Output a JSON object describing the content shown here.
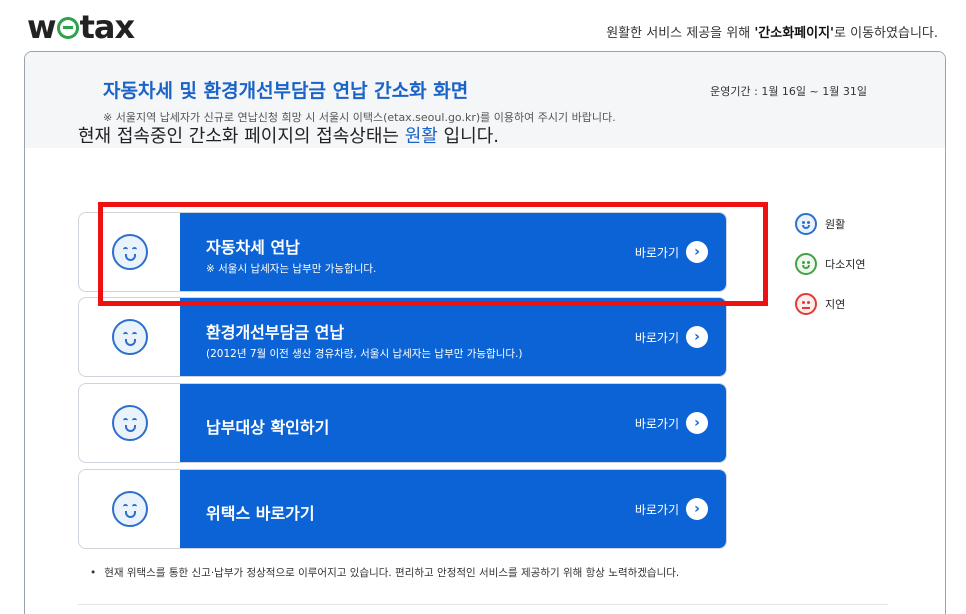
{
  "header": {
    "logo": "wetax",
    "notice_prefix": "원활한 서비스 제공을 위해 ",
    "notice_strong": "'간소화페이지'",
    "notice_suffix": "로 이동하였습니다."
  },
  "panel": {
    "title": "자동차세 및 환경개선부담금 연납 간소화 화면",
    "subtitle": "※ 서울지역 납세자가 신규로 연납신청 희망 시 서울시 이택스(etax.seoul.go.kr)를 이용하여 주시기 바랍니다.",
    "period": "운영기간 : 1월 16일 ~ 1월 31일"
  },
  "status": {
    "prefix": "현재 접속중인 간소화 페이지의 접속상태는 ",
    "value": "원활",
    "suffix": " 입니다."
  },
  "menu": [
    {
      "title": "자동차세 연납",
      "desc": "※ 서울시 납세자는 납부만 가능합니다.",
      "go_label": "바로가기"
    },
    {
      "title": "환경개선부담금 연납",
      "desc": "(2012년 7월 이전 생산 경유차량, 서울시 납세자는 납부만 가능합니다.)",
      "go_label": "바로가기"
    },
    {
      "title": "납부대상 확인하기",
      "desc": "",
      "go_label": "바로가기"
    },
    {
      "title": "위택스 바로가기",
      "desc": "",
      "go_label": "바로가기"
    }
  ],
  "legend": [
    {
      "label": "원활",
      "status": "smooth",
      "color": "#2d6fce"
    },
    {
      "label": "다소지연",
      "status": "slightly-delayed",
      "color": "#43a047"
    },
    {
      "label": "지연",
      "status": "delayed",
      "color": "#e53935"
    }
  ],
  "footer_note": "현재 위택스를 통한 신고·납부가 정상적으로 이루어지고 있습니다. 편리하고 안정적인 서비스를 제공하기 위해 항상 노력하겠습니다.",
  "icons": {
    "arrow": "chevron-right-icon",
    "status_face": "smiley-face-icon"
  },
  "colors": {
    "accent": "#0b63d6",
    "title_blue": "#1a63c7",
    "highlight": "#ee1111"
  }
}
